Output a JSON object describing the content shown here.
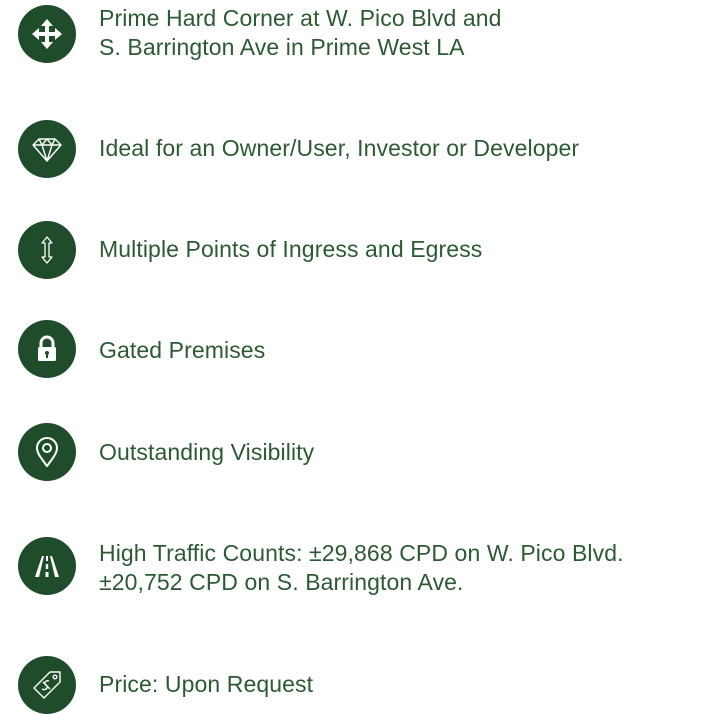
{
  "features": [
    {
      "icon": "move-arrows-icon",
      "lines": [
        "Prime Hard Corner at W. Pico Blvd and",
        "S. Barrington Ave in Prime West LA"
      ]
    },
    {
      "icon": "diamond-icon",
      "lines": [
        "Ideal for an Owner/User, Investor or Developer"
      ]
    },
    {
      "icon": "up-down-arrow-icon",
      "lines": [
        "Multiple Points of Ingress and Egress"
      ]
    },
    {
      "icon": "padlock-icon",
      "lines": [
        "Gated Premises"
      ]
    },
    {
      "icon": "map-pin-icon",
      "lines": [
        "Outstanding Visibility"
      ]
    },
    {
      "icon": "road-icon",
      "lines": [
        "High Traffic Counts: ±29,868 CPD on W. Pico Blvd.",
        "±20,752 CPD on S. Barrington Ave."
      ]
    },
    {
      "icon": "price-tag-icon",
      "lines": [
        "Price:  Upon Request"
      ]
    }
  ],
  "colors": {
    "icon_bg": "#1f4d2b",
    "text": "#2c5a33"
  }
}
